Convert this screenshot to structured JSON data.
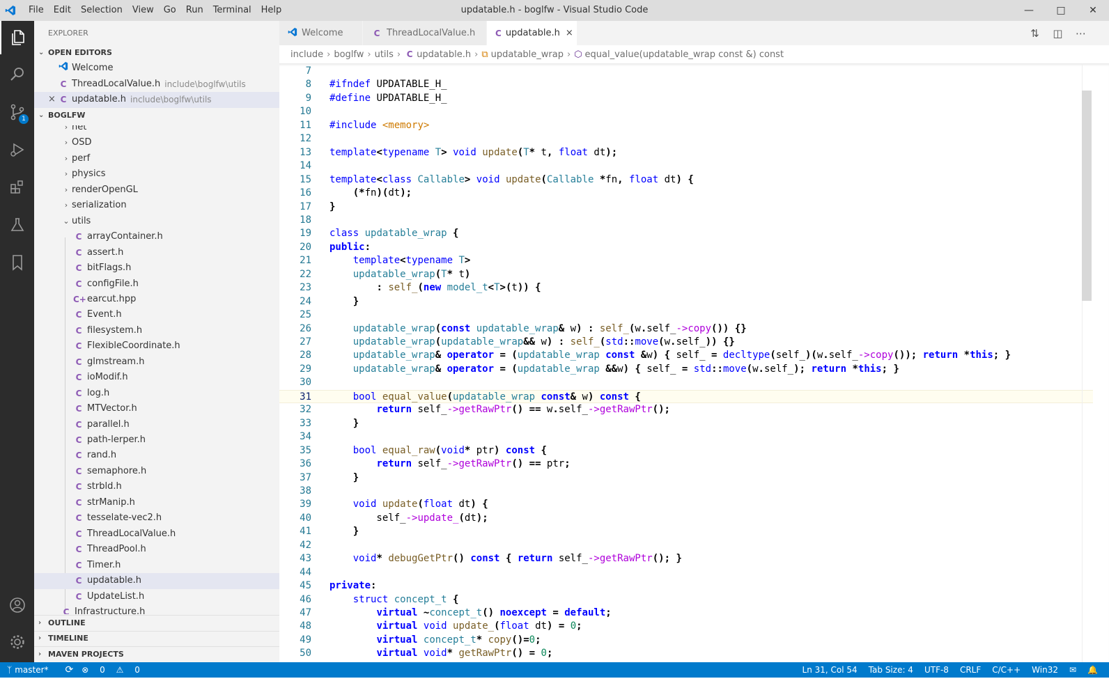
{
  "window": {
    "title": "updatable.h - boglfw - Visual Studio Code",
    "menu": [
      "File",
      "Edit",
      "Selection",
      "View",
      "Go",
      "Run",
      "Terminal",
      "Help"
    ],
    "controls": [
      "minimize-icon",
      "maximize-icon",
      "close-icon"
    ]
  },
  "activity": {
    "items": [
      "explorer-icon",
      "search-icon",
      "source-control-icon",
      "run-debug-icon",
      "extensions-icon",
      "testing-icon",
      "bookmarks-icon"
    ],
    "scm_badge": "1",
    "bottom": [
      "account-icon",
      "settings-gear-icon"
    ]
  },
  "sidebar": {
    "title": "EXPLORER",
    "open_editors_label": "OPEN EDITORS",
    "open_editors": [
      {
        "name": "Welcome",
        "desc": "",
        "icon": "vscode-icon"
      },
      {
        "name": "ThreadLocalValue.h",
        "desc": "include\\boglfw\\utils",
        "icon": "c-file-icon"
      },
      {
        "name": "updatable.h",
        "desc": "include\\boglfw\\utils",
        "icon": "c-file-icon",
        "active": true
      }
    ],
    "project_label": "BOGLFW",
    "folders_top": [
      {
        "name": "net"
      },
      {
        "name": "OSD"
      },
      {
        "name": "perf"
      },
      {
        "name": "physics"
      },
      {
        "name": "renderOpenGL"
      },
      {
        "name": "serialization"
      }
    ],
    "utils_folder": "utils",
    "files": [
      {
        "name": "arrayContainer.h",
        "icon": "C"
      },
      {
        "name": "assert.h",
        "icon": "C"
      },
      {
        "name": "bitFlags.h",
        "icon": "C"
      },
      {
        "name": "configFile.h",
        "icon": "C"
      },
      {
        "name": "earcut.hpp",
        "icon": "C+"
      },
      {
        "name": "Event.h",
        "icon": "C"
      },
      {
        "name": "filesystem.h",
        "icon": "C"
      },
      {
        "name": "FlexibleCoordinate.h",
        "icon": "C"
      },
      {
        "name": "glmstream.h",
        "icon": "C"
      },
      {
        "name": "ioModif.h",
        "icon": "C"
      },
      {
        "name": "log.h",
        "icon": "C"
      },
      {
        "name": "MTVector.h",
        "icon": "C"
      },
      {
        "name": "parallel.h",
        "icon": "C"
      },
      {
        "name": "path-lerper.h",
        "icon": "C"
      },
      {
        "name": "rand.h",
        "icon": "C"
      },
      {
        "name": "semaphore.h",
        "icon": "C"
      },
      {
        "name": "strbld.h",
        "icon": "C"
      },
      {
        "name": "strManip.h",
        "icon": "C"
      },
      {
        "name": "tesselate-vec2.h",
        "icon": "C"
      },
      {
        "name": "ThreadLocalValue.h",
        "icon": "C"
      },
      {
        "name": "ThreadPool.h",
        "icon": "C"
      },
      {
        "name": "Timer.h",
        "icon": "C"
      },
      {
        "name": "updatable.h",
        "icon": "C",
        "selected": true
      },
      {
        "name": "UpdateList.h",
        "icon": "C"
      }
    ],
    "trailing_file": "Infrastructure.h",
    "bottom_sections": [
      "OUTLINE",
      "TIMELINE",
      "MAVEN PROJECTS"
    ]
  },
  "tabs": [
    {
      "label": "Welcome",
      "icon": "vscode-icon",
      "active": false
    },
    {
      "label": "ThreadLocalValue.h",
      "icon": "c-file-icon",
      "active": false
    },
    {
      "label": "updatable.h",
      "icon": "c-file-icon",
      "active": true,
      "close": "×"
    }
  ],
  "tab_actions": [
    "open-changes-icon",
    "split-editor-icon",
    "more-actions-icon"
  ],
  "breadcrumb": [
    "include",
    "boglfw",
    "utils",
    "updatable.h",
    "updatable_wrap",
    "equal_value(updatable_wrap const &) const"
  ],
  "editor": {
    "current_line": 31,
    "lines": [
      {
        "n": "7",
        "code": ""
      },
      {
        "n": "8",
        "code": "#ifndef UPDATABLE_H_"
      },
      {
        "n": "9",
        "code": "#define UPDATABLE_H_"
      },
      {
        "n": "10",
        "code": ""
      },
      {
        "n": "11",
        "code": "#include <memory>"
      },
      {
        "n": "12",
        "code": ""
      },
      {
        "n": "13",
        "code": "template<typename T> void update(T* t, float dt);"
      },
      {
        "n": "14",
        "code": ""
      },
      {
        "n": "15",
        "code": "template<class Callable> void update(Callable *fn, float dt) {"
      },
      {
        "n": "16",
        "code": "    (*fn)(dt);"
      },
      {
        "n": "17",
        "code": "}"
      },
      {
        "n": "18",
        "code": ""
      },
      {
        "n": "19",
        "code": "class updatable_wrap {"
      },
      {
        "n": "20",
        "code": "public:"
      },
      {
        "n": "21",
        "code": "    template<typename T>"
      },
      {
        "n": "22",
        "code": "    updatable_wrap(T* t)"
      },
      {
        "n": "23",
        "code": "        : self_(new model_t<T>(t)) {"
      },
      {
        "n": "24",
        "code": "    }"
      },
      {
        "n": "25",
        "code": ""
      },
      {
        "n": "26",
        "code": "    updatable_wrap(const updatable_wrap& w) : self_(w.self_->copy()) {}"
      },
      {
        "n": "27",
        "code": "    updatable_wrap(updatable_wrap&& w) : self_(std::move(w.self_)) {}"
      },
      {
        "n": "28",
        "code": "    updatable_wrap& operator = (updatable_wrap const &w) { self_ = decltype(self_)(w.self_->copy()); return *this; }"
      },
      {
        "n": "29",
        "code": "    updatable_wrap& operator = (updatable_wrap &&w) { self_ = std::move(w.self_); return *this; }"
      },
      {
        "n": "30",
        "code": ""
      },
      {
        "n": "31",
        "code": "    bool equal_value(updatable_wrap const& w) const {"
      },
      {
        "n": "32",
        "code": "        return self_->getRawPtr() == w.self_->getRawPtr();"
      },
      {
        "n": "33",
        "code": "    }"
      },
      {
        "n": "34",
        "code": ""
      },
      {
        "n": "35",
        "code": "    bool equal_raw(void* ptr) const {"
      },
      {
        "n": "36",
        "code": "        return self_->getRawPtr() == ptr;"
      },
      {
        "n": "37",
        "code": "    }"
      },
      {
        "n": "38",
        "code": ""
      },
      {
        "n": "39",
        "code": "    void update(float dt) {"
      },
      {
        "n": "40",
        "code": "        self_->update_(dt);"
      },
      {
        "n": "41",
        "code": "    }"
      },
      {
        "n": "42",
        "code": ""
      },
      {
        "n": "43",
        "code": "    void* debugGetPtr() const { return self_->getRawPtr(); }"
      },
      {
        "n": "44",
        "code": ""
      },
      {
        "n": "45",
        "code": "private:"
      },
      {
        "n": "46",
        "code": "    struct concept_t {"
      },
      {
        "n": "47",
        "code": "        virtual ~concept_t() noexcept = default;"
      },
      {
        "n": "48",
        "code": "        virtual void update_(float dt) = 0;"
      },
      {
        "n": "49",
        "code": "        virtual concept_t* copy()=0;"
      },
      {
        "n": "50",
        "code": "        virtual void* getRawPtr() = 0;"
      }
    ]
  },
  "statusbar": {
    "branch": "master*",
    "sync": "sync-icon",
    "errors": "0",
    "warnings": "0",
    "position": "Ln 31, Col 54",
    "tab_size": "Tab Size: 4",
    "encoding": "UTF-8",
    "eol": "CRLF",
    "language": "C/C++",
    "platform": "Win32"
  },
  "colors": {
    "accent": "#007acc",
    "activitybar": "#2c2c2c",
    "sidebar": "#f3f3f3",
    "titlebar": "#dddddd",
    "c_icon": "#8e5bb5"
  }
}
